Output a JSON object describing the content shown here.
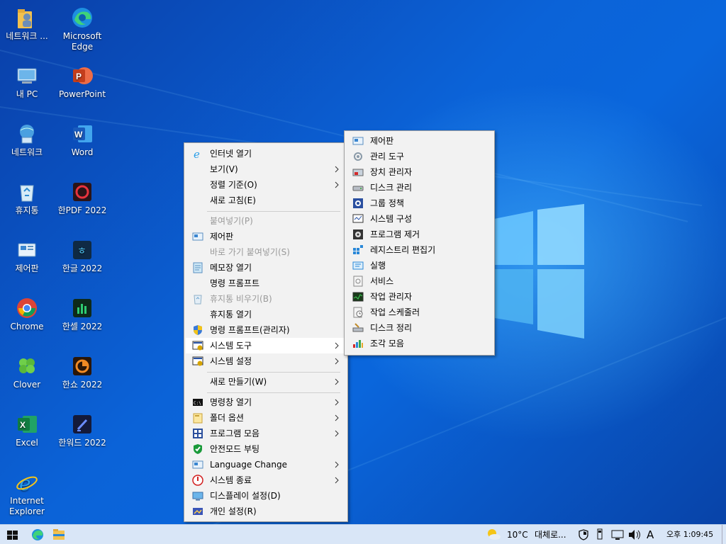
{
  "desktop_icons": [
    {
      "label": "네트워크 ...",
      "icon": "user-folder-icon"
    },
    {
      "label": "Microsoft Edge",
      "icon": "edge-icon"
    },
    {
      "label": "내 PC",
      "icon": "computer-icon"
    },
    {
      "label": "PowerPoint",
      "icon": "powerpoint-icon"
    },
    {
      "label": "네트워크",
      "icon": "network-icon"
    },
    {
      "label": "Word",
      "icon": "word-icon"
    },
    {
      "label": "휴지통",
      "icon": "recycle-bin-icon"
    },
    {
      "label": "한PDF 2022",
      "icon": "hanpdf-icon"
    },
    {
      "label": "제어판",
      "icon": "control-panel-icon"
    },
    {
      "label": "한글 2022",
      "icon": "hangul-icon"
    },
    {
      "label": "Chrome",
      "icon": "chrome-icon"
    },
    {
      "label": "한셀 2022",
      "icon": "hancell-icon"
    },
    {
      "label": "Clover",
      "icon": "clover-icon"
    },
    {
      "label": "한쇼 2022",
      "icon": "hanshow-icon"
    },
    {
      "label": "Excel",
      "icon": "excel-icon"
    },
    {
      "label": "한워드 2022",
      "icon": "hanword-icon"
    },
    {
      "label": "Internet Explorer",
      "icon": "ie-icon"
    }
  ],
  "context_menu": {
    "items": [
      {
        "label": "인터넷 열기",
        "icon": "ie-icon"
      },
      {
        "label": "보기(V)",
        "submenu": true
      },
      {
        "label": "정렬 기준(O)",
        "submenu": true
      },
      {
        "label": "새로 고침(E)"
      },
      {
        "label": "붙여넣기(P)",
        "disabled": true
      },
      {
        "label": "제어판",
        "icon": "control-panel-icon"
      },
      {
        "label": "바로 가기 붙여넣기(S)",
        "disabled": true
      },
      {
        "label": "메모장 열기",
        "icon": "notepad-icon"
      },
      {
        "label": "명령 프롬프트"
      },
      {
        "label": "휴지통 비우기(B)",
        "icon": "recycle-bin-icon",
        "disabled": true
      },
      {
        "label": "휴지통 열기"
      },
      {
        "label": "명령 프롬프트(관리자)",
        "icon": "shield-icon"
      },
      {
        "label": "시스템 도구",
        "icon": "system-tools-icon",
        "submenu": true,
        "highlighted": true
      },
      {
        "label": "시스템 설정",
        "icon": "system-settings-icon",
        "submenu": true
      },
      {
        "label": "새로 만들기(W)",
        "submenu": true
      },
      {
        "label": "명령창 열기",
        "icon": "cmd-icon",
        "submenu": true
      },
      {
        "label": "폴더 옵션",
        "icon": "folder-icon",
        "submenu": true
      },
      {
        "label": "프로그램 모음",
        "icon": "programs-icon",
        "submenu": true
      },
      {
        "label": "안전모드 부팅",
        "icon": "safe-mode-icon"
      },
      {
        "label": "Language Change",
        "icon": "language-icon",
        "submenu": true
      },
      {
        "label": "시스템 종료",
        "icon": "power-icon",
        "submenu": true
      },
      {
        "label": "디스플레이 설정(D)",
        "icon": "display-icon"
      },
      {
        "label": "개인 설정(R)",
        "icon": "personalize-icon"
      }
    ]
  },
  "system_tools_submenu": {
    "items": [
      {
        "label": "제어판",
        "icon": "control-panel-icon"
      },
      {
        "label": "관리 도구",
        "icon": "admin-tools-icon"
      },
      {
        "label": "장치 관리자",
        "icon": "device-manager-icon"
      },
      {
        "label": "디스크 관리",
        "icon": "disk-management-icon"
      },
      {
        "label": "그룹 정책",
        "icon": "group-policy-icon"
      },
      {
        "label": "시스템 구성",
        "icon": "system-config-icon"
      },
      {
        "label": "프로그램 제거",
        "icon": "uninstall-icon"
      },
      {
        "label": "레지스트리 편집기",
        "icon": "registry-icon"
      },
      {
        "label": "실행",
        "icon": "run-icon"
      },
      {
        "label": "서비스",
        "icon": "services-icon"
      },
      {
        "label": "작업 관리자",
        "icon": "task-manager-icon"
      },
      {
        "label": "작업 스케줄러",
        "icon": "task-scheduler-icon"
      },
      {
        "label": "디스크 정리",
        "icon": "disk-cleanup-icon"
      },
      {
        "label": "조각 모음",
        "icon": "defrag-icon"
      }
    ]
  },
  "taskbar": {
    "weather": {
      "temp": "10°C",
      "desc": "대체로..."
    },
    "input_indicator": "A",
    "clock": "오후 1:09:45"
  },
  "colors": {
    "accent": "#0a63d8",
    "menu_bg": "#f2f2f2",
    "taskbar_bg": "#d9e6f7"
  }
}
